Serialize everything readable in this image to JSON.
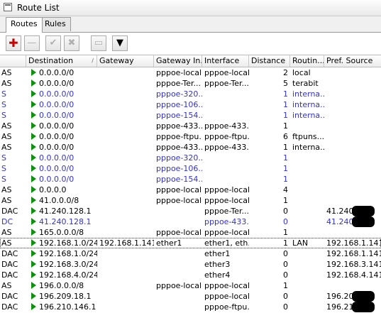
{
  "window": {
    "title": "Route List"
  },
  "tabs": [
    {
      "label": "Routes",
      "active": true
    },
    {
      "label": "Rules",
      "active": false
    }
  ],
  "toolbar": [
    {
      "name": "add-button",
      "glyph": "✚",
      "enabled": true
    },
    {
      "name": "remove-button",
      "glyph": "—",
      "enabled": false
    },
    {
      "name": "enable-button",
      "glyph": "✔",
      "enabled": false
    },
    {
      "name": "disable-button",
      "glyph": "✖",
      "enabled": false
    },
    {
      "name": "comment-button",
      "glyph": "▭",
      "enabled": false
    },
    {
      "name": "filter-button",
      "glyph": "▼",
      "enabled": true
    }
  ],
  "columns": [
    "",
    "Destination",
    "Gateway",
    "Gateway In...",
    "Interface",
    "Distance",
    "Routin...",
    "Pref. Source"
  ],
  "routes": [
    {
      "flags": "AS",
      "dest": "0.0.0.0/0",
      "gw": "",
      "gwif": "pppoe-local",
      "iface": "pppoe-local",
      "dist": "2",
      "mark": "local",
      "src": "",
      "style": "normal"
    },
    {
      "flags": "AS",
      "dest": "0.0.0.0/0",
      "gw": "",
      "gwif": "pppoe-Ter...",
      "iface": "pppoe-Ter...",
      "dist": "5",
      "mark": "terabit",
      "src": "",
      "style": "normal"
    },
    {
      "flags": "S",
      "dest": "0.0.0.0/0",
      "gw": "",
      "gwif": "pppoe-320...",
      "iface": "",
      "dist": "1",
      "mark": "interna...",
      "src": "",
      "style": "s"
    },
    {
      "flags": "S",
      "dest": "0.0.0.0/0",
      "gw": "",
      "gwif": "pppoe-106...",
      "iface": "",
      "dist": "1",
      "mark": "interna...",
      "src": "",
      "style": "s"
    },
    {
      "flags": "S",
      "dest": "0.0.0.0/0",
      "gw": "",
      "gwif": "pppoe-154...",
      "iface": "",
      "dist": "1",
      "mark": "interna...",
      "src": "",
      "style": "s"
    },
    {
      "flags": "AS",
      "dest": "0.0.0.0/0",
      "gw": "",
      "gwif": "pppoe-433...",
      "iface": "pppoe-433...",
      "dist": "1",
      "mark": "",
      "src": "",
      "style": "normal"
    },
    {
      "flags": "AS",
      "dest": "0.0.0.0/0",
      "gw": "",
      "gwif": "pppoe-ftpu...",
      "iface": "pppoe-ftpu...",
      "dist": "6",
      "mark": "ftpuns...",
      "src": "",
      "style": "normal"
    },
    {
      "flags": "AS",
      "dest": "0.0.0.0/0",
      "gw": "",
      "gwif": "pppoe-433...",
      "iface": "pppoe-433...",
      "dist": "1",
      "mark": "interna...",
      "src": "",
      "style": "normal"
    },
    {
      "flags": "S",
      "dest": "0.0.0.0/0",
      "gw": "",
      "gwif": "pppoe-320...",
      "iface": "",
      "dist": "1",
      "mark": "",
      "src": "",
      "style": "s"
    },
    {
      "flags": "S",
      "dest": "0.0.0.0/0",
      "gw": "",
      "gwif": "pppoe-106...",
      "iface": "",
      "dist": "1",
      "mark": "",
      "src": "",
      "style": "s"
    },
    {
      "flags": "S",
      "dest": "0.0.0.0/0",
      "gw": "",
      "gwif": "pppoe-154...",
      "iface": "",
      "dist": "1",
      "mark": "",
      "src": "",
      "style": "s"
    },
    {
      "flags": "AS",
      "dest": "0.0.0.0",
      "gw": "",
      "gwif": "pppoe-local",
      "iface": "pppoe-local",
      "dist": "4",
      "mark": "",
      "src": "",
      "style": "normal"
    },
    {
      "flags": "AS",
      "dest": "41.0.0.0/8",
      "gw": "",
      "gwif": "pppoe-local",
      "iface": "pppoe-local",
      "dist": "1",
      "mark": "",
      "src": "",
      "style": "normal"
    },
    {
      "flags": "DAC",
      "dest": "41.240.128.1",
      "gw": "",
      "gwif": "",
      "iface": "pppoe-Ter...",
      "dist": "0",
      "mark": "",
      "src": "41.240.",
      "style": "normal",
      "redacted": true
    },
    {
      "flags": "DC",
      "dest": "41.240.128.1",
      "gw": "",
      "gwif": "",
      "iface": "pppoe-433...",
      "dist": "0",
      "mark": "",
      "src": "41.240.",
      "style": "dc",
      "redacted": true
    },
    {
      "flags": "AS",
      "dest": "165.0.0.0/8",
      "gw": "",
      "gwif": "pppoe-local",
      "iface": "pppoe-local",
      "dist": "1",
      "mark": "",
      "src": "",
      "style": "normal"
    },
    {
      "flags": "AS",
      "dest": "192.168.1.0/24",
      "gw": "192.168.1.141",
      "gwif": "ether1",
      "iface": "ether1, eth...",
      "dist": "1",
      "mark": "LAN",
      "src": "192.168.1.141",
      "style": "normal",
      "selected": true
    },
    {
      "flags": "DAC",
      "dest": "192.168.1.0/24",
      "gw": "",
      "gwif": "",
      "iface": "ether1",
      "dist": "0",
      "mark": "",
      "src": "192.168.1.141",
      "style": "normal"
    },
    {
      "flags": "DAC",
      "dest": "192.168.3.0/24",
      "gw": "",
      "gwif": "",
      "iface": "ether3",
      "dist": "0",
      "mark": "",
      "src": "192.168.3.141",
      "style": "normal"
    },
    {
      "flags": "DAC",
      "dest": "192.168.4.0/24",
      "gw": "",
      "gwif": "",
      "iface": "ether4",
      "dist": "0",
      "mark": "",
      "src": "192.168.4.141",
      "style": "normal"
    },
    {
      "flags": "AS",
      "dest": "196.0.0.0/8",
      "gw": "",
      "gwif": "pppoe-local",
      "iface": "pppoe-local",
      "dist": "1",
      "mark": "",
      "src": "",
      "style": "normal"
    },
    {
      "flags": "DAC",
      "dest": "196.209.18.1",
      "gw": "",
      "gwif": "",
      "iface": "pppoe-local",
      "dist": "0",
      "mark": "",
      "src": "196.209",
      "style": "normal",
      "redacted": true
    },
    {
      "flags": "DAC",
      "dest": "196.210.146.1",
      "gw": "",
      "gwif": "",
      "iface": "pppoe-ftpu...",
      "dist": "0",
      "mark": "",
      "src": "196.210",
      "style": "normal",
      "redacted": true
    }
  ]
}
